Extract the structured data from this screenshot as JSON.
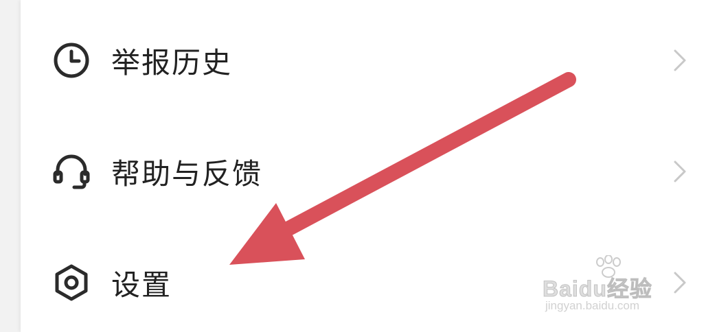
{
  "menu": {
    "items": [
      {
        "label": "举报历史",
        "icon": "clock-icon"
      },
      {
        "label": "帮助与反馈",
        "icon": "headset-icon"
      },
      {
        "label": "设置",
        "icon": "hexagon-settings-icon"
      }
    ]
  },
  "annotation": {
    "arrow_color": "#d9515a"
  },
  "watermark": {
    "brand": "Baidu经验",
    "url": "jingyan.baidu.com"
  }
}
